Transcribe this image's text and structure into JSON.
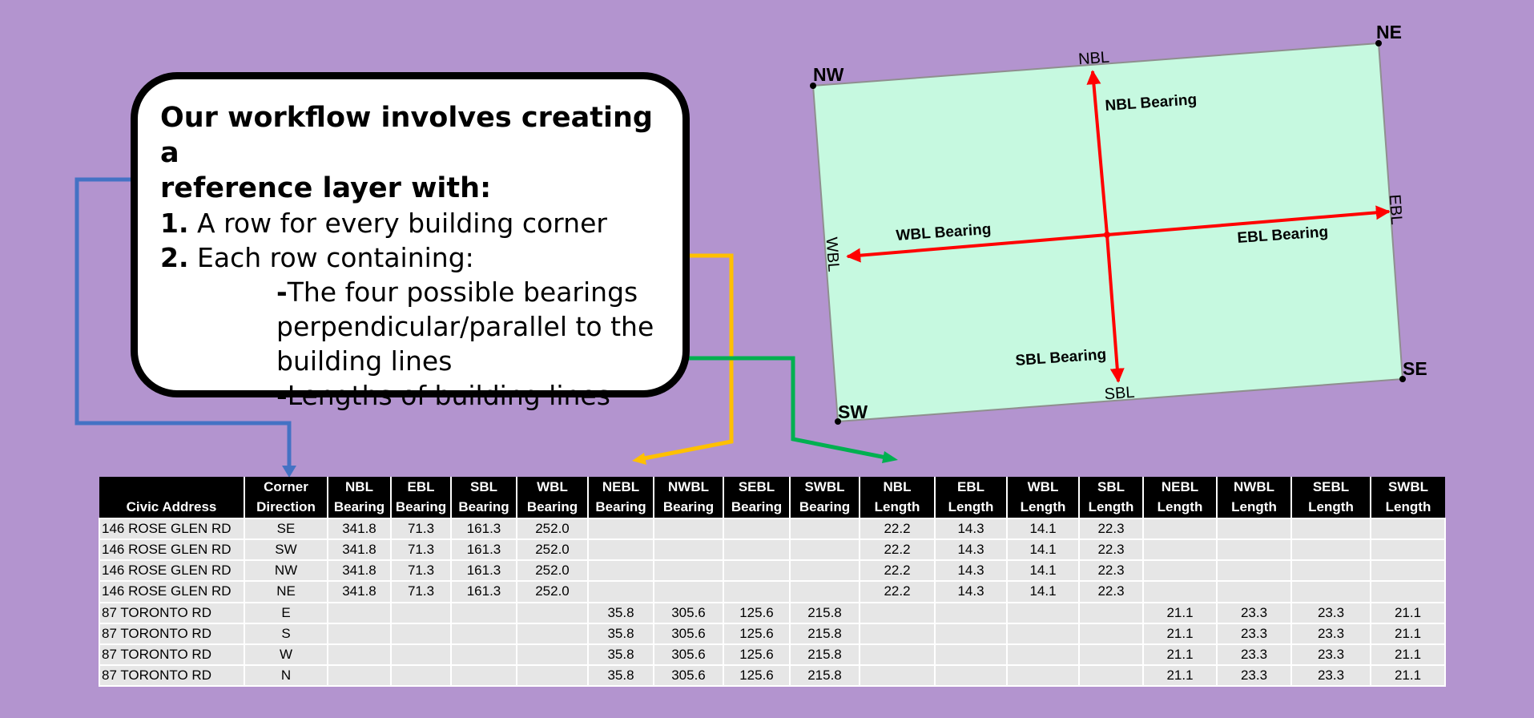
{
  "callout": {
    "heading_line1": "Our workflow involves creating a",
    "heading_line2": "reference layer with:",
    "item1_num": "1.",
    "item1_text": "A row for every building corner",
    "item2_num": "2.",
    "item2_text": "Each row containing:",
    "sub1_dash": "-",
    "sub1_line1": "The four possible bearings",
    "sub1_line2": "perpendicular/parallel to the",
    "sub1_line3": "building lines",
    "sub2_dash": "-",
    "sub2_text": "Lengths of building lines"
  },
  "diagram": {
    "corners": {
      "nw": "NW",
      "ne": "NE",
      "sw": "SW",
      "se": "SE"
    },
    "edges": {
      "top": "NBL",
      "right": "EBL",
      "bottom": "SBL",
      "left": "WBL"
    },
    "arrows": {
      "n": "NBL Bearing",
      "e": "EBL Bearing",
      "s": "SBL Bearing",
      "w": "WBL Bearing"
    }
  },
  "colors": {
    "background": "#b394cf",
    "building_fill": "#c6f9e0",
    "arrow": "#ff0000",
    "connector_blue": "#4472c4",
    "connector_yellow": "#ffc000",
    "connector_green": "#00b050"
  },
  "table": {
    "headers": [
      [
        "",
        "Civic Address"
      ],
      [
        "Corner",
        "Direction"
      ],
      [
        "NBL",
        "Bearing"
      ],
      [
        "EBL",
        "Bearing"
      ],
      [
        "SBL",
        "Bearing"
      ],
      [
        "WBL",
        "Bearing"
      ],
      [
        "NEBL",
        "Bearing"
      ],
      [
        "NWBL",
        "Bearing"
      ],
      [
        "SEBL",
        "Bearing"
      ],
      [
        "SWBL",
        "Bearing"
      ],
      [
        "NBL",
        "Length"
      ],
      [
        "EBL",
        "Length"
      ],
      [
        "WBL",
        "Length"
      ],
      [
        "SBL",
        "Length"
      ],
      [
        "NEBL",
        "Length"
      ],
      [
        "NWBL",
        "Length"
      ],
      [
        "SEBL",
        "Length"
      ],
      [
        "SWBL",
        "Length"
      ]
    ],
    "rows": [
      [
        "146 ROSE GLEN RD",
        "SE",
        "341.8",
        "71.3",
        "161.3",
        "252.0",
        "",
        "",
        "",
        "",
        "22.2",
        "14.3",
        "14.1",
        "22.3",
        "",
        "",
        "",
        ""
      ],
      [
        "146 ROSE GLEN RD",
        "SW",
        "341.8",
        "71.3",
        "161.3",
        "252.0",
        "",
        "",
        "",
        "",
        "22.2",
        "14.3",
        "14.1",
        "22.3",
        "",
        "",
        "",
        ""
      ],
      [
        "146 ROSE GLEN RD",
        "NW",
        "341.8",
        "71.3",
        "161.3",
        "252.0",
        "",
        "",
        "",
        "",
        "22.2",
        "14.3",
        "14.1",
        "22.3",
        "",
        "",
        "",
        ""
      ],
      [
        "146 ROSE GLEN RD",
        "NE",
        "341.8",
        "71.3",
        "161.3",
        "252.0",
        "",
        "",
        "",
        "",
        "22.2",
        "14.3",
        "14.1",
        "22.3",
        "",
        "",
        "",
        ""
      ],
      [
        "87 TORONTO RD",
        "E",
        "",
        "",
        "",
        "",
        "35.8",
        "305.6",
        "125.6",
        "215.8",
        "",
        "",
        "",
        "",
        "21.1",
        "23.3",
        "23.3",
        "21.1"
      ],
      [
        "87 TORONTO RD",
        "S",
        "",
        "",
        "",
        "",
        "35.8",
        "305.6",
        "125.6",
        "215.8",
        "",
        "",
        "",
        "",
        "21.1",
        "23.3",
        "23.3",
        "21.1"
      ],
      [
        "87 TORONTO RD",
        "W",
        "",
        "",
        "",
        "",
        "35.8",
        "305.6",
        "125.6",
        "215.8",
        "",
        "",
        "",
        "",
        "21.1",
        "23.3",
        "23.3",
        "21.1"
      ],
      [
        "87 TORONTO RD",
        "N",
        "",
        "",
        "",
        "",
        "35.8",
        "305.6",
        "125.6",
        "215.8",
        "",
        "",
        "",
        "",
        "21.1",
        "23.3",
        "23.3",
        "21.1"
      ]
    ]
  }
}
